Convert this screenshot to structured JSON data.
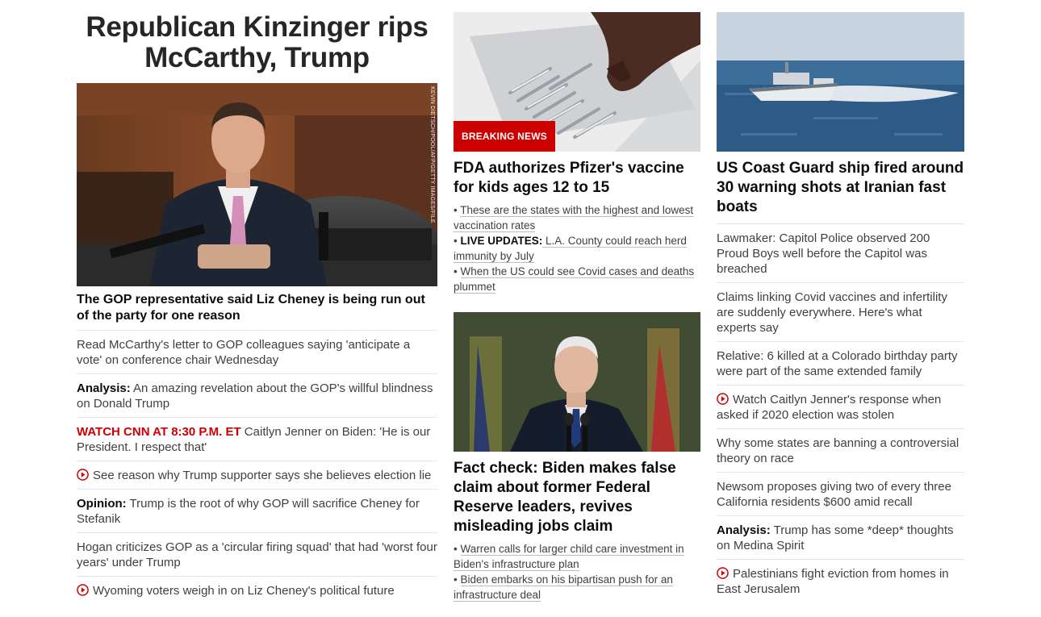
{
  "column1": {
    "main_headline": "Republican Kinzinger rips McCarthy, Trump",
    "photo_credit": "KEVIN DIETSCH/POOL/AFP/GETTY IMAGES/FILE",
    "lead": "The GOP representative said Liz Cheney is being run out of the party for one reason",
    "items": [
      {
        "kicker": "",
        "text": "Read McCarthy's letter to GOP colleagues saying 'anticipate a vote' on conference chair Wednesday",
        "video": false
      },
      {
        "kicker": "Analysis:",
        "text": " An amazing revelation about the GOP's willful blindness on Donald Trump",
        "video": false
      },
      {
        "kicker": "WATCH CNN AT 8:30 P.M. ET",
        "text": " Caitlyn Jenner on Biden: 'He is our President. I respect that'",
        "video": false
      },
      {
        "kicker": "",
        "text": "See reason why Trump supporter says she believes election lie",
        "video": true
      },
      {
        "kicker": "Opinion:",
        "text": " Trump is the root of why GOP will sacrifice Cheney for Stefanik",
        "video": false
      },
      {
        "kicker": "",
        "text": "Hogan criticizes GOP as a 'circular firing squad' that had 'worst four years' under Trump",
        "video": false
      },
      {
        "kicker": "",
        "text": "Wyoming voters weigh in on Liz Cheney's political future",
        "video": true
      }
    ]
  },
  "column2": {
    "card1": {
      "badge": "BREAKING NEWS",
      "headline": "FDA authorizes Pfizer's vaccine for kids ages 12 to 15",
      "subs": [
        {
          "kicker": "",
          "text": "These are the states with the highest and lowest vaccination rates"
        },
        {
          "kicker": "LIVE UPDATES:",
          "text": " L.A. County could reach herd immunity by July"
        },
        {
          "kicker": "",
          "text": "When the US could see Covid cases and deaths plummet"
        }
      ]
    },
    "card2": {
      "headline": "Fact check: Biden makes false claim about former Federal Reserve leaders, revives misleading jobs claim",
      "subs": [
        {
          "kicker": "",
          "text": "Warren calls for larger child care investment in Biden's infrastructure plan"
        },
        {
          "kicker": "",
          "text": "Biden embarks on his bipartisan push for an infrastructure deal"
        }
      ]
    },
    "bullet": "•"
  },
  "column3": {
    "headline": "US Coast Guard ship fired around 30 warning shots at Iranian fast boats",
    "items": [
      {
        "kicker": "",
        "text": "Lawmaker: Capitol Police observed 200 Proud Boys well before the Capitol was breached",
        "video": false
      },
      {
        "kicker": "",
        "text": "Claims linking Covid vaccines and infertility are suddenly everywhere. Here's what experts say",
        "video": false
      },
      {
        "kicker": "",
        "text": "Relative: 6 killed at a Colorado birthday party were part of the same extended family",
        "video": false
      },
      {
        "kicker": "",
        "text": "Watch Caitlyn Jenner's response when asked if 2020 election was stolen",
        "video": true
      },
      {
        "kicker": "",
        "text": "Why some states are banning a controversial theory on race",
        "video": false
      },
      {
        "kicker": "",
        "text": "Newsom proposes giving two of every three California residents $600 amid recall",
        "video": false
      },
      {
        "kicker": "Analysis:",
        "text": " Trump has some *deep* thoughts on Medina Spirit",
        "video": false
      },
      {
        "kicker": "",
        "text": "Palestinians fight eviction from homes in East Jerusalem",
        "video": true
      }
    ]
  },
  "colors": {
    "accent_red": "#cc0000",
    "text": "#262626",
    "divider": "#e6e6e6"
  },
  "icons": {
    "video": "play-circle-icon"
  }
}
